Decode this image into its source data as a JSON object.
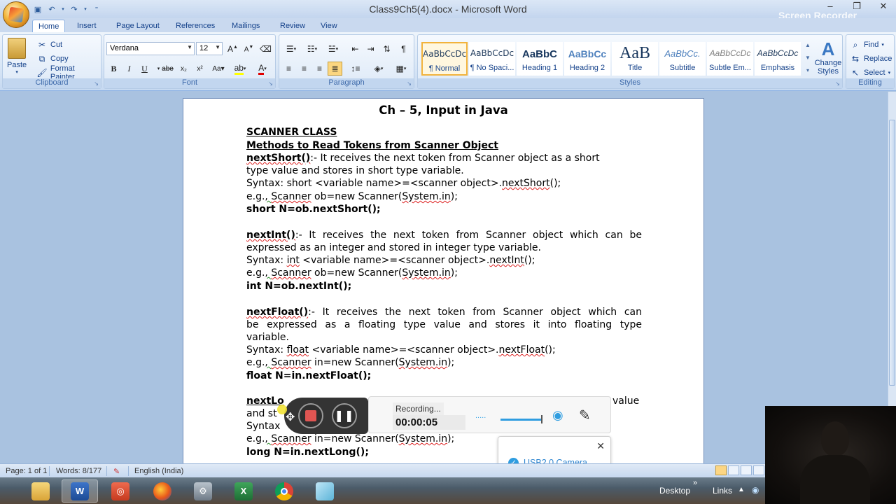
{
  "window": {
    "title": "Class9Ch5(4).docx - Microsoft Word",
    "controls": [
      "minimize",
      "restore",
      "close"
    ]
  },
  "watermark": "Screen Recorder",
  "quick_access": [
    {
      "icon": "save-icon"
    },
    {
      "icon": "undo-icon"
    },
    {
      "icon": "redo-icon"
    },
    {
      "icon": "customize-icon"
    }
  ],
  "tabs": [
    "Home",
    "Insert",
    "Page Layout",
    "References",
    "Mailings",
    "Review",
    "View"
  ],
  "active_tab": "Home",
  "ribbon": {
    "clipboard": {
      "label": "Clipboard",
      "paste": "Paste",
      "cut": "Cut",
      "copy": "Copy",
      "format_painter": "Format Painter"
    },
    "font": {
      "label": "Font",
      "font_name": "Verdana",
      "font_size": "12"
    },
    "paragraph": {
      "label": "Paragraph"
    },
    "styles": {
      "label": "Styles",
      "change_styles": "Change Styles",
      "items": [
        {
          "sample": "AaBbCcDc",
          "name": "¶ Normal"
        },
        {
          "sample": "AaBbCcDc",
          "name": "¶ No Spaci..."
        },
        {
          "sample": "AaBbC",
          "name": "Heading 1"
        },
        {
          "sample": "AaBbCc",
          "name": "Heading 2"
        },
        {
          "sample": "AaB",
          "name": "Title"
        },
        {
          "sample": "AaBbCc.",
          "name": "Subtitle"
        },
        {
          "sample": "AaBbCcDc",
          "name": "Subtle Em..."
        },
        {
          "sample": "AaBbCcDc",
          "name": "Emphasis"
        }
      ],
      "selected": "¶ Normal"
    },
    "editing": {
      "label": "Editing",
      "find": "Find",
      "replace": "Replace",
      "select": "Select"
    }
  },
  "document": {
    "title": "Ch – 5, Input in Java",
    "heading1": "SCANNER CLASS",
    "heading2": "Methods to Read Tokens from Scanner Object",
    "short": {
      "name": "nextShort()",
      "desc1": ":- It receives the next token from Scanner object as a short",
      "desc2": "type value and stores in short type variable.",
      "syntax_prefix": "Syntax:  short <variable name>=<scanner object>.",
      "syntax_method": "nextShort",
      "syntax_suffix": "();",
      "eg_prefix": "e.g.",
      "eg_scanner": "Scanner",
      "eg_mid": " ob=new Scanner(",
      "eg_sys": "System.in",
      "eg_end": ");",
      "code": "short N=ob.nextShort();"
    },
    "int": {
      "name": "nextInt()",
      "desc1": ":- It receives the next token from Scanner object which can be",
      "desc2": "expressed as an integer and stored in integer type variable.",
      "syntax_prefix": "Syntax:  ",
      "syntax_kw": "int",
      "syntax_mid": "  <variable name>=<scanner object>.",
      "syntax_method": "nextInt",
      "syntax_suffix": "();",
      "eg_prefix": "e.g.",
      "eg_scanner": "Scanner",
      "eg_mid": " ob=new Scanner(",
      "eg_sys": "System.in",
      "eg_end": ");",
      "code": "int N=ob.nextInt();"
    },
    "float": {
      "name": "nextFloat()",
      "desc1": ":- It receives the next token from Scanner object which can",
      "desc2": "be expressed as a floating type value and stores it into floating type",
      "desc3": "variable.",
      "syntax_prefix": "Syntax:  ",
      "syntax_kw": "float",
      "syntax_mid": "  <variable name>=<scanner object>.",
      "syntax_method": "nextFloat",
      "syntax_suffix": "();",
      "eg_prefix": "e.g.",
      "eg_scanner": "Scanner",
      "eg_mid": " in=new Scanner(",
      "eg_sys": "System.in",
      "eg_end": ");",
      "code": "float N=in.nextFloat();"
    },
    "long": {
      "name_visible": "nextLo",
      "desc1_tail": "value",
      "desc2_visible": "and st",
      "syntax_visible": "Syntax",
      "eg_prefix": "e.g.",
      "eg_scanner": "Scanner",
      "eg_mid": " in=new Scanner(",
      "eg_sys": "System.in",
      "eg_end": ");",
      "code": "long N=in.nextLong();"
    }
  },
  "recorder": {
    "status": "Recording...",
    "time": "00:00:05",
    "dots": ".....",
    "camera_label": "USB2.0 Camera"
  },
  "statusbar": {
    "page": "Page: 1 of 1",
    "words": "Words: 8/177",
    "language": "English (India)"
  },
  "taskbar": {
    "apps": [
      {
        "name": "file-explorer",
        "icon": "folder-icon",
        "active": false
      },
      {
        "name": "word",
        "icon": "word-icon",
        "active": true
      },
      {
        "name": "recorder-app",
        "icon": "recorder-app-icon",
        "active": false
      },
      {
        "name": "firefox",
        "icon": "firefox-icon",
        "active": false
      },
      {
        "name": "tool",
        "icon": "tool-icon",
        "active": false
      },
      {
        "name": "excel",
        "icon": "excel-icon",
        "active": false
      },
      {
        "name": "chrome",
        "icon": "chrome-icon",
        "active": false
      },
      {
        "name": "notes",
        "icon": "notes-icon",
        "active": false
      }
    ],
    "desktop": "Desktop",
    "links": "Links"
  },
  "colors": {
    "ribbon_accent": "#15428b",
    "recording_red": "#e05552",
    "camera_blue": "#2f9de0",
    "selection_gold": "#f2b33c"
  }
}
